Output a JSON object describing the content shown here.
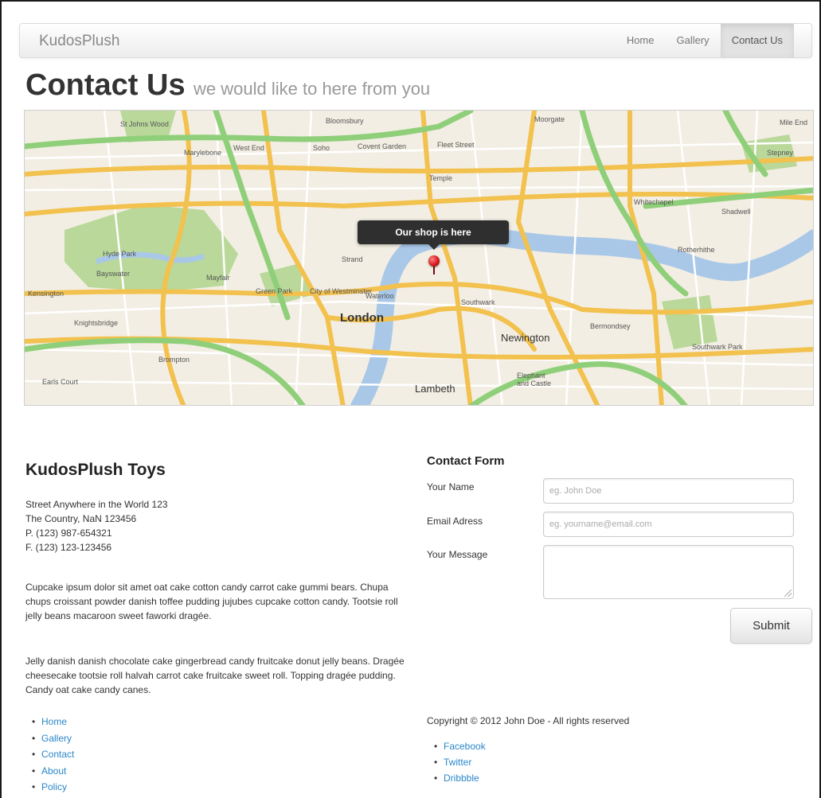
{
  "navbar": {
    "brand": "KudosPlush",
    "items": [
      {
        "label": "Home",
        "active": false
      },
      {
        "label": "Gallery",
        "active": false
      },
      {
        "label": "Contact Us",
        "active": true
      }
    ]
  },
  "header": {
    "title": "Contact Us",
    "subtitle": "we would like to here from you"
  },
  "map": {
    "tooltip": "Our shop is here",
    "labels": {
      "london": "London",
      "lambeth": "Lambeth",
      "hyde_park": "Hyde Park",
      "bayswater": "Bayswater",
      "mayfair": "Mayfair",
      "kensington": "Kensington",
      "knightsbridge": "Knightsbridge",
      "marylebone": "Marylebone",
      "west_end": "West End",
      "soho": "Soho",
      "covent_garden": "Covent Garden",
      "fleet_street": "Fleet Street",
      "temple": "Temple",
      "strand": "Strand",
      "city_of_westminster": "City of Westminster",
      "waterloo": "Waterloo",
      "southwark": "Southwark",
      "newington": "Newington",
      "bermondsey": "Bermondsey",
      "whitechapel": "Whitechapel",
      "moorgate": "Moorgate",
      "bloomsbury": "Bloomsbury",
      "st_johns_wood": "St Johns Wood",
      "green_park": "Green Park",
      "brompton": "Brompton",
      "earls_court": "Earls Court",
      "elephant_castle": "Elephant and Castle",
      "stepney": "Stepney",
      "mile_end": "Mile End",
      "shadwell": "Shadwell",
      "rotherhithe": "Rotherhithe",
      "southwark_park": "Southwark Park"
    },
    "colors": {
      "land": "#f3eee3",
      "water": "#a9c8e8",
      "park": "#b9d89a",
      "major_road": "#f2c14e",
      "motorway": "#8fcf7a",
      "minor_road": "#ffffff"
    }
  },
  "shop": {
    "title": "KudosPlush Toys",
    "address_lines": [
      "Street Anywhere in the World 123",
      "The Country, NaN 123456",
      "P. (123) 987-654321",
      "F. (123) 123-123456"
    ],
    "paragraphs": [
      "Cupcake ipsum dolor sit amet oat cake cotton candy carrot cake gummi bears. Chupa chups croissant powder danish toffee pudding jujubes cupcake cotton candy. Tootsie roll jelly beans macaroon sweet faworki dragée.",
      "Jelly danish danish chocolate cake gingerbread candy fruitcake donut jelly beans. Dragée cheesecake tootsie roll halvah carrot cake fruitcake sweet roll. Topping dragée pudding. Candy oat cake candy canes."
    ],
    "links": [
      "Home",
      "Gallery",
      "Contact",
      "About",
      "Policy"
    ]
  },
  "form": {
    "title": "Contact Form",
    "name_label": "Your Name",
    "name_placeholder": "eg. John Doe",
    "email_label": "Email Adress",
    "email_placeholder": "eg. yourname@email.com",
    "message_label": "Your Message",
    "submit_label": "Submit"
  },
  "footer": {
    "copyright": "Copyright © 2012 John Doe - All rights reserved",
    "social_links": [
      "Facebook",
      "Twitter",
      "Dribbble"
    ]
  }
}
